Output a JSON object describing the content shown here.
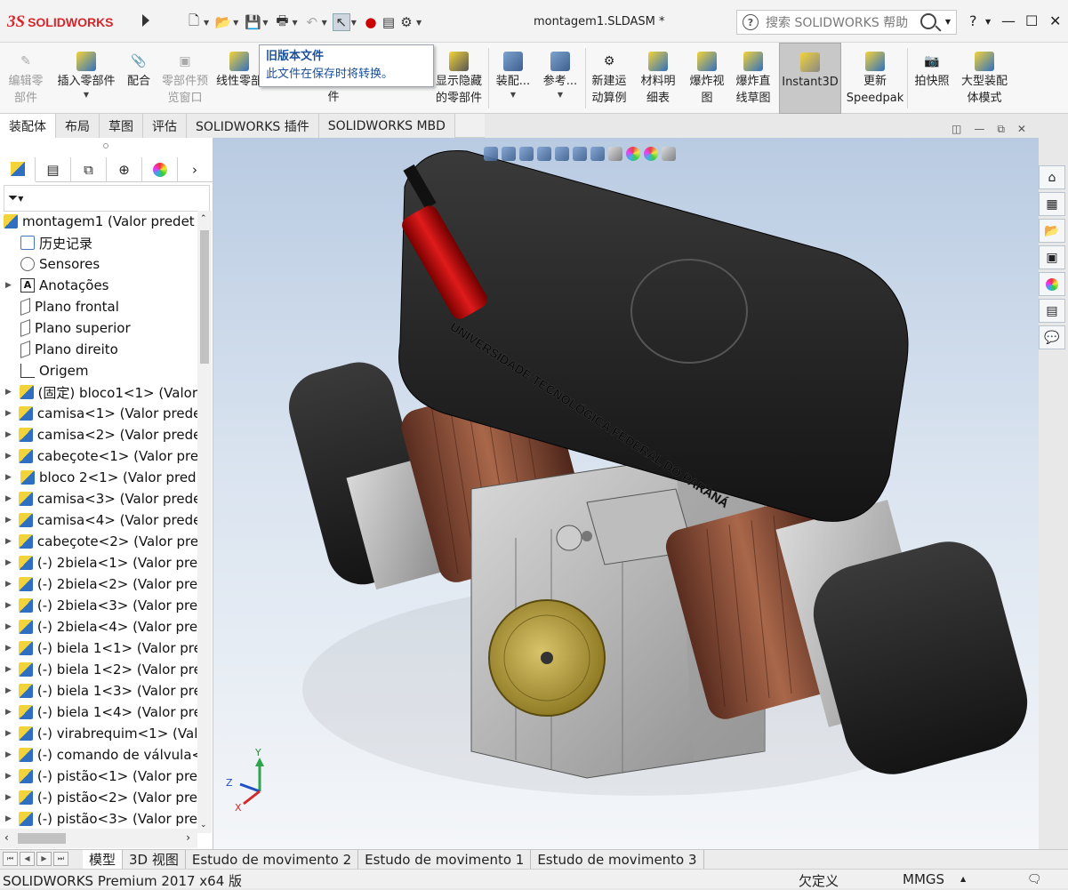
{
  "app": {
    "logo_ds": "3S",
    "logo_text": "SOLIDWORKS",
    "doc_title": "montagem1.SLDASM *"
  },
  "search": {
    "placeholder": "搜索 SOLIDWORKS 帮助"
  },
  "window_buttons": {
    "help": "?",
    "minimize": "—",
    "maximize": "☐",
    "close": "✕"
  },
  "ribbon": {
    "edit_component": "编辑零\n部件",
    "insert_component": "插入零部件",
    "mate": "配合",
    "component_preview": "零部件预\n览窗口",
    "linear_pattern": "线性零部",
    "pattern_suffix": "件",
    "show_hidden": "显示隐藏\n的零部件",
    "assembly_features": "装配...",
    "reference": "参考...",
    "new_motion_study": "新建运\n动算例",
    "bom": "材料明\n细表",
    "exploded_view": "爆炸视\n图",
    "explode_line": "爆炸直\n线草图",
    "instant3d": "Instant3D",
    "update_speedpak": "更新\nSpeedpak",
    "snapshot": "拍快照",
    "large_assembly": "大型装配\n体模式"
  },
  "tooltip": {
    "title": "旧版本文件",
    "body": "此文件在保存时将转换。"
  },
  "tabs": [
    "装配体",
    "布局",
    "草图",
    "评估",
    "SOLIDWORKS 插件",
    "SOLIDWORKS MBD"
  ],
  "tree": {
    "root": "montagem1  (Valor predet",
    "items": [
      {
        "label": "历史记录",
        "icon": "history-icon",
        "expand": false
      },
      {
        "label": "Sensores",
        "icon": "sensor-icon",
        "expand": false
      },
      {
        "label": "Anotações",
        "icon": "annotation-icon",
        "expand": true
      },
      {
        "label": "Plano frontal",
        "icon": "plane-icon",
        "expand": false
      },
      {
        "label": "Plano superior",
        "icon": "plane-icon",
        "expand": false
      },
      {
        "label": "Plano direito",
        "icon": "plane-icon",
        "expand": false
      },
      {
        "label": "Origem",
        "icon": "origin-icon",
        "expand": false
      },
      {
        "label": "(固定) bloco1<1> (Valor",
        "icon": "component-icon",
        "expand": true
      },
      {
        "label": "camisa<1> (Valor prede",
        "icon": "component-icon",
        "expand": true
      },
      {
        "label": "camisa<2> (Valor prede",
        "icon": "component-icon",
        "expand": true
      },
      {
        "label": "cabeçote<1> (Valor pre",
        "icon": "component-icon",
        "expand": true
      },
      {
        "label": "bloco 2<1> (Valor pred",
        "icon": "component-icon",
        "expand": true
      },
      {
        "label": "camisa<3> (Valor prede",
        "icon": "component-icon",
        "expand": true
      },
      {
        "label": "camisa<4> (Valor prede",
        "icon": "component-icon",
        "expand": true
      },
      {
        "label": "cabeçote<2> (Valor pre",
        "icon": "component-icon",
        "expand": true
      },
      {
        "label": "(-) 2biela<1> (Valor pre",
        "icon": "component-icon",
        "expand": true
      },
      {
        "label": "(-) 2biela<2> (Valor pre",
        "icon": "component-icon",
        "expand": true
      },
      {
        "label": "(-) 2biela<3> (Valor pre",
        "icon": "component-icon",
        "expand": true
      },
      {
        "label": "(-) 2biela<4> (Valor pre",
        "icon": "component-icon",
        "expand": true
      },
      {
        "label": "(-) biela 1<1> (Valor pre",
        "icon": "component-icon",
        "expand": true
      },
      {
        "label": "(-) biela 1<2> (Valor pre",
        "icon": "component-icon",
        "expand": true
      },
      {
        "label": "(-) biela 1<3> (Valor pre",
        "icon": "component-icon",
        "expand": true
      },
      {
        "label": "(-) biela 1<4> (Valor pre",
        "icon": "component-icon",
        "expand": true
      },
      {
        "label": "(-) virabrequim<1> (Val",
        "icon": "component-icon",
        "expand": true
      },
      {
        "label": "(-) comando de válvula<",
        "icon": "component-icon",
        "expand": true
      },
      {
        "label": "(-) pistão<1> (Valor pre",
        "icon": "component-icon",
        "expand": true
      },
      {
        "label": "(-) pistão<2> (Valor pre",
        "icon": "component-icon",
        "expand": true
      },
      {
        "label": "(-) pistão<3> (Valor pre",
        "icon": "component-icon",
        "expand": true
      }
    ]
  },
  "model_engraving": "UNIVERSIDADE TECNOLÓGICA FEDERAL DO PARANÁ",
  "triad": {
    "x": "X",
    "y": "Y",
    "z": "Z"
  },
  "bottom_tabs": [
    "模型",
    "3D 视图",
    "Estudo de movimento 2",
    "Estudo de movimento 1",
    "Estudo de movimento 3"
  ],
  "status": {
    "product": "SOLIDWORKS Premium 2017 x64 版",
    "state": "欠定义",
    "units": "MMGS"
  },
  "colors": {
    "brand": "#d6262b",
    "tooltip_text": "#1a4f9c",
    "viewport_top": "#b9cbe2"
  }
}
